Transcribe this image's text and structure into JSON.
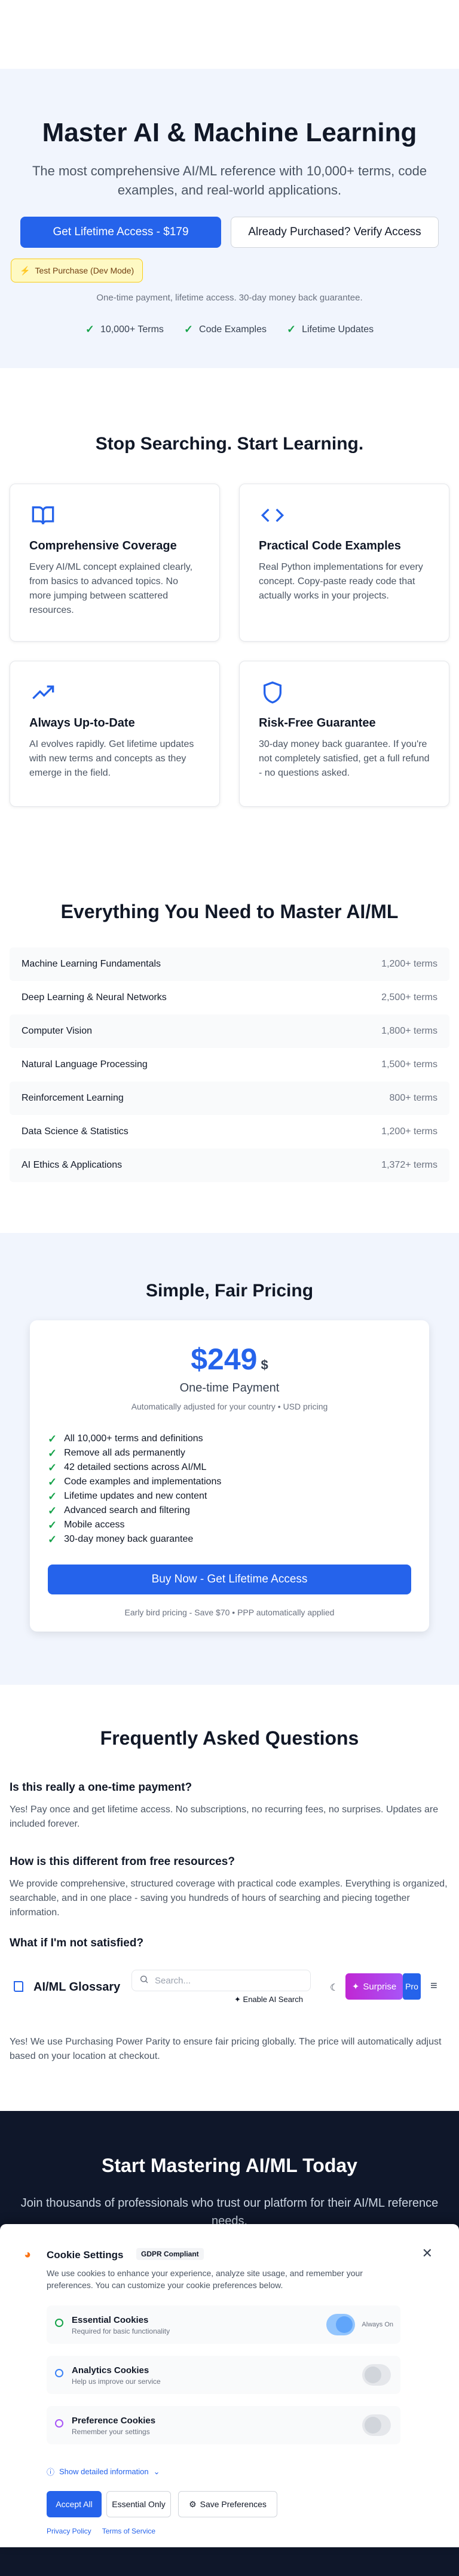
{
  "hero": {
    "title": "Master AI & Machine Learning",
    "subtitle": "The most comprehensive AI/ML reference with 10,000+ terms, code examples, and real-world applications.",
    "primary_cta": "Get Lifetime Access - $179",
    "secondary_cta": "Already Purchased? Verify Access",
    "test_badge": "Test Purchase (Dev Mode)",
    "note": "One-time payment, lifetime access. 30-day money back guarantee.",
    "checks": [
      "10,000+ Terms",
      "Code Examples",
      "Lifetime Updates"
    ]
  },
  "benefits": {
    "title": "Stop Searching. Start Learning.",
    "cards": [
      {
        "icon": "book-icon",
        "title": "Comprehensive Coverage",
        "text": "Every AI/ML concept explained clearly, from basics to advanced topics. No more jumping between scattered resources."
      },
      {
        "icon": "code-icon",
        "title": "Practical Code Examples",
        "text": "Real Python implementations for every concept. Copy-paste ready code that actually works in your projects."
      },
      {
        "icon": "trending-up-icon",
        "title": "Always Up-to-Date",
        "text": "AI evolves rapidly. Get lifetime updates with new terms and concepts as they emerge in the field."
      },
      {
        "icon": "shield-icon",
        "title": "Risk-Free Guarantee",
        "text": "30-day money back guarantee. If you're not completely satisfied, get a full refund - no questions asked."
      }
    ]
  },
  "topics": {
    "title": "Everything You Need to Master AI/ML",
    "items": [
      {
        "name": "Machine Learning Fundamentals",
        "count": "1,200+ terms"
      },
      {
        "name": "Deep Learning & Neural Networks",
        "count": "2,500+ terms"
      },
      {
        "name": "Computer Vision",
        "count": "1,800+ terms"
      },
      {
        "name": "Natural Language Processing",
        "count": "1,500+ terms"
      },
      {
        "name": "Reinforcement Learning",
        "count": "800+ terms"
      },
      {
        "name": "Data Science & Statistics",
        "count": "1,200+ terms"
      },
      {
        "name": "AI Ethics & Applications",
        "count": "1,372+ terms"
      }
    ]
  },
  "pricing": {
    "title": "Simple, Fair Pricing",
    "price": "$249",
    "currency": "$",
    "label": "One-time Payment",
    "sub": "Automatically adjusted for your country • USD pricing",
    "features": [
      "All 10,000+ terms and definitions",
      "Remove all ads permanently",
      "42 detailed sections across AI/ML",
      "Code examples and implementations",
      "Lifetime updates and new content",
      "Advanced search and filtering",
      "Mobile access",
      "30-day money back guarantee"
    ],
    "buy": "Buy Now - Get Lifetime Access",
    "early": "Early bird pricing - Save $70 • PPP automatically applied"
  },
  "faq": {
    "title": "Frequently Asked Questions",
    "items": [
      {
        "q": "Is this really a one-time payment?",
        "a": "Yes! Pay once and get lifetime access. No subscriptions, no recurring fees, no surprises. Updates are included forever."
      },
      {
        "q": "How is this different from free resources?",
        "a": "We provide comprehensive, structured coverage with practical code examples. Everything is organized, searchable, and in one place - saving you hundreds of hours of searching and piecing together information."
      },
      {
        "q": "What if I'm not satisfied?",
        "a": "Yes! We use Purchasing Power Parity to ensure fair pricing globally. The price will automatically adjust based on your location at checkout."
      }
    ]
  },
  "glossary_bar": {
    "logo": "AI/ML Glossary",
    "search_placeholder": "Search...",
    "ai_search": "Enable AI Search",
    "surprise": "Surprise",
    "pro": "Pro"
  },
  "cta": {
    "title": "Start Mastering AI/ML Today",
    "sub": "Join thousands of professionals who trust our platform for their AI/ML reference needs."
  },
  "cookie": {
    "title": "Cookie Settings",
    "badge": "GDPR Compliant",
    "desc": "We use cookies to enhance your experience, analyze site usage, and remember your preferences. You can customize your cookie preferences below.",
    "rows": [
      {
        "name": "Essential Cookies",
        "desc": "Required for basic functionality",
        "always": "Always On"
      },
      {
        "name": "Analytics Cookies",
        "desc": "Help us improve our service"
      },
      {
        "name": "Preference Cookies",
        "desc": "Remember your settings"
      }
    ],
    "show_details": "Show detailed information",
    "accept": "Accept All",
    "essential": "Essential Only",
    "save": "Save Preferences",
    "privacy": "Privacy Policy",
    "terms": "Terms of Service"
  }
}
